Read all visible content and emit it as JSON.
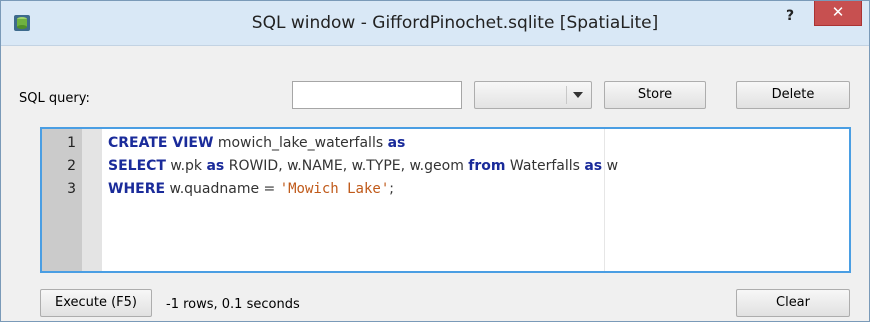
{
  "window": {
    "title": "SQL window - GiffordPinochet.sqlite [SpatiaLite]",
    "help_label": "?",
    "close_label": "✕",
    "icon": "database-icon"
  },
  "query_bar": {
    "label": "SQL query:",
    "name_value": "",
    "select_value": "",
    "store_label": "Store",
    "delete_label": "Delete"
  },
  "editor": {
    "line_numbers": [
      "1",
      "2",
      "3"
    ],
    "lines": [
      [
        {
          "text": "CREATE VIEW",
          "kind": "kw"
        },
        {
          "text": " mowich_lake_waterfalls ",
          "kind": "plain"
        },
        {
          "text": "as",
          "kind": "kw"
        }
      ],
      [
        {
          "text": "SELECT",
          "kind": "kw"
        },
        {
          "text": " w.pk ",
          "kind": "plain"
        },
        {
          "text": "as",
          "kind": "kw"
        },
        {
          "text": " ROWID, w.NAME, w.TYPE, w.geom ",
          "kind": "plain"
        },
        {
          "text": "from",
          "kind": "kw"
        },
        {
          "text": " Waterfalls ",
          "kind": "plain"
        },
        {
          "text": "as",
          "kind": "kw"
        },
        {
          "text": " w",
          "kind": "plain"
        }
      ],
      [
        {
          "text": "WHERE",
          "kind": "kw"
        },
        {
          "text": " w.quadname = ",
          "kind": "plain"
        },
        {
          "text": "'Mowich Lake'",
          "kind": "str"
        },
        {
          "text": ";",
          "kind": "plain"
        }
      ]
    ]
  },
  "footer": {
    "execute_label": "Execute (F5)",
    "status_text": "-1 rows, 0.1 seconds",
    "clear_label": "Clear"
  },
  "colors": {
    "titlebar": "#d9e8f6",
    "close_button": "#c75050",
    "editor_border": "#4a9ee3",
    "keyword": "#1a2b9a",
    "string": "#c05a1a"
  }
}
